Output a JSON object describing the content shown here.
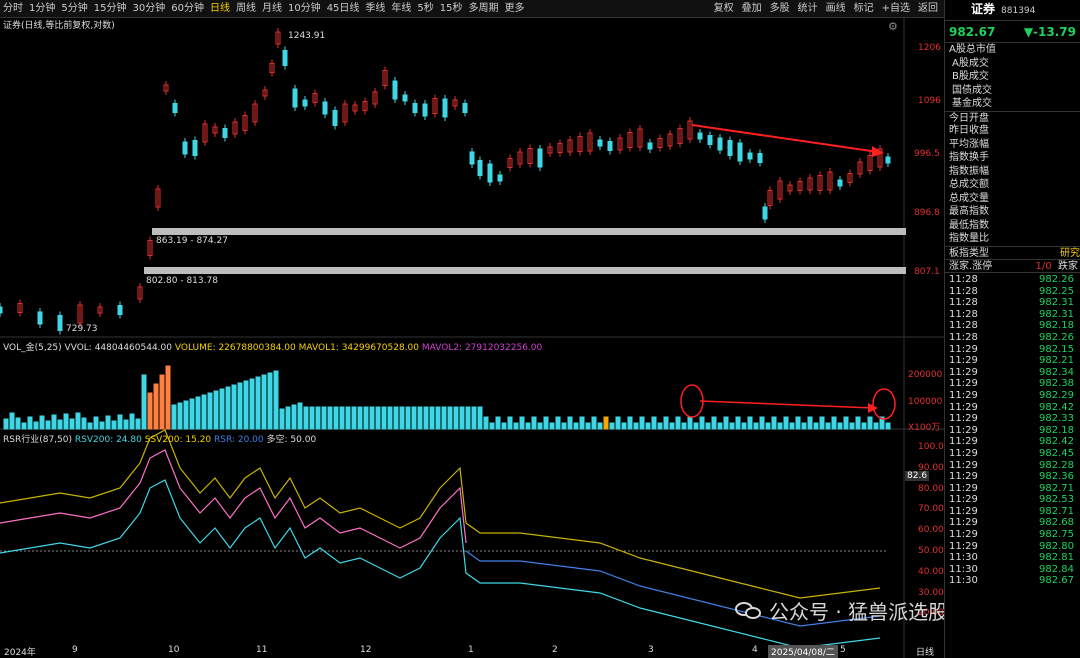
{
  "toolbar": {
    "timeframes": [
      "分时",
      "1分钟",
      "5分钟",
      "15分钟",
      "30分钟",
      "60分钟",
      "日线",
      "周线",
      "月线",
      "10分钟",
      "45日线",
      "季线",
      "年线",
      "5秒",
      "15秒",
      "多周期",
      "更多"
    ],
    "active_index": 6,
    "tools": [
      "复权",
      "叠加",
      "多股",
      "统计",
      "画线",
      "标记",
      "+自选",
      "返回"
    ]
  },
  "main_chart": {
    "title": "证券(日线,等比前复权,对数)",
    "y_labels": [
      "1206",
      "1096",
      "996.5",
      "896.8",
      "807.1"
    ],
    "high_label": "1243.91",
    "low_label": "729.73",
    "zone1_label": "863.19 - 874.27",
    "zone2_label": "802.80 - 813.78"
  },
  "volume_panel": {
    "title": "VOL_金(5,25)",
    "vvol": "VVOL: 44804460544.00",
    "volume": "VOLUME: 22678800384.00",
    "mavol1": "MAVOL1: 34299670528.00",
    "mavol2": "MAVOL2: 27912032256.00",
    "y_labels": [
      "200000",
      "100000",
      "X100万"
    ]
  },
  "rsr_panel": {
    "title": "RSR行业(87,50)",
    "rsv200": "RSV200: 24.80",
    "ssv200": "SSV200: 15.20",
    "rsr": "RSR: 20.00",
    "duokong": "多空: 50.00",
    "y_labels": [
      "100.0",
      "90.00",
      "80.00",
      "70.00",
      "60.00",
      "50.00",
      "40.00",
      "30.00",
      "20.00"
    ],
    "current_badge": "82.6"
  },
  "x_axis": {
    "labels": [
      "2024年",
      "9",
      "10",
      "11",
      "12",
      "1",
      "2",
      "3",
      "4",
      "5"
    ],
    "cursor_date": "2025/04/08/二",
    "period": "日线"
  },
  "sidebar": {
    "name": "证券",
    "code": "881394",
    "price": "982.67",
    "change": "▼-13.79",
    "fields": [
      "A股总市值",
      "A股成交",
      "B股成交",
      "国债成交",
      "基金成交",
      "今日开盘",
      "昨日收盘",
      "平均涨幅",
      "指数换手",
      "指数振幅",
      "总成交额",
      "总成交量",
      "最高指数",
      "最低指数",
      "指数量比",
      "板指类型"
    ],
    "board_type_value": "研究",
    "limit_label": "涨家.涨停",
    "limit_value": "1/0",
    "limit_right": "跌家",
    "ticks": [
      {
        "t": "11:28",
        "v": "982.26"
      },
      {
        "t": "11:28",
        "v": "982.25"
      },
      {
        "t": "11:28",
        "v": "982.31"
      },
      {
        "t": "11:28",
        "v": "982.31"
      },
      {
        "t": "11:28",
        "v": "982.18"
      },
      {
        "t": "11:28",
        "v": "982.26"
      },
      {
        "t": "11:29",
        "v": "982.15"
      },
      {
        "t": "11:29",
        "v": "982.21"
      },
      {
        "t": "11:29",
        "v": "982.34"
      },
      {
        "t": "11:29",
        "v": "982.38"
      },
      {
        "t": "11:29",
        "v": "982.29"
      },
      {
        "t": "11:29",
        "v": "982.42"
      },
      {
        "t": "11:29",
        "v": "982.33"
      },
      {
        "t": "11:29",
        "v": "982.18"
      },
      {
        "t": "11:29",
        "v": "982.42"
      },
      {
        "t": "11:29",
        "v": "982.45"
      },
      {
        "t": "11:29",
        "v": "982.28"
      },
      {
        "t": "11:29",
        "v": "982.36"
      },
      {
        "t": "11:29",
        "v": "982.71"
      },
      {
        "t": "11:29",
        "v": "982.53"
      },
      {
        "t": "11:29",
        "v": "982.71"
      },
      {
        "t": "11:29",
        "v": "982.68"
      },
      {
        "t": "11:29",
        "v": "982.75"
      },
      {
        "t": "11:29",
        "v": "982.80"
      },
      {
        "t": "11:30",
        "v": "982.81"
      },
      {
        "t": "11:30",
        "v": "982.84"
      },
      {
        "t": "11:30",
        "v": "982.67"
      }
    ]
  },
  "watermark": "公众号 · 猛兽派选股",
  "colors": {
    "up": "#e03030",
    "down": "#3fd7e6",
    "volume_up_strong": "#ff8040",
    "volume_yellow": "#f5a800",
    "magenta_line": "#ff70c8",
    "yellow_line": "#c8b400"
  }
}
